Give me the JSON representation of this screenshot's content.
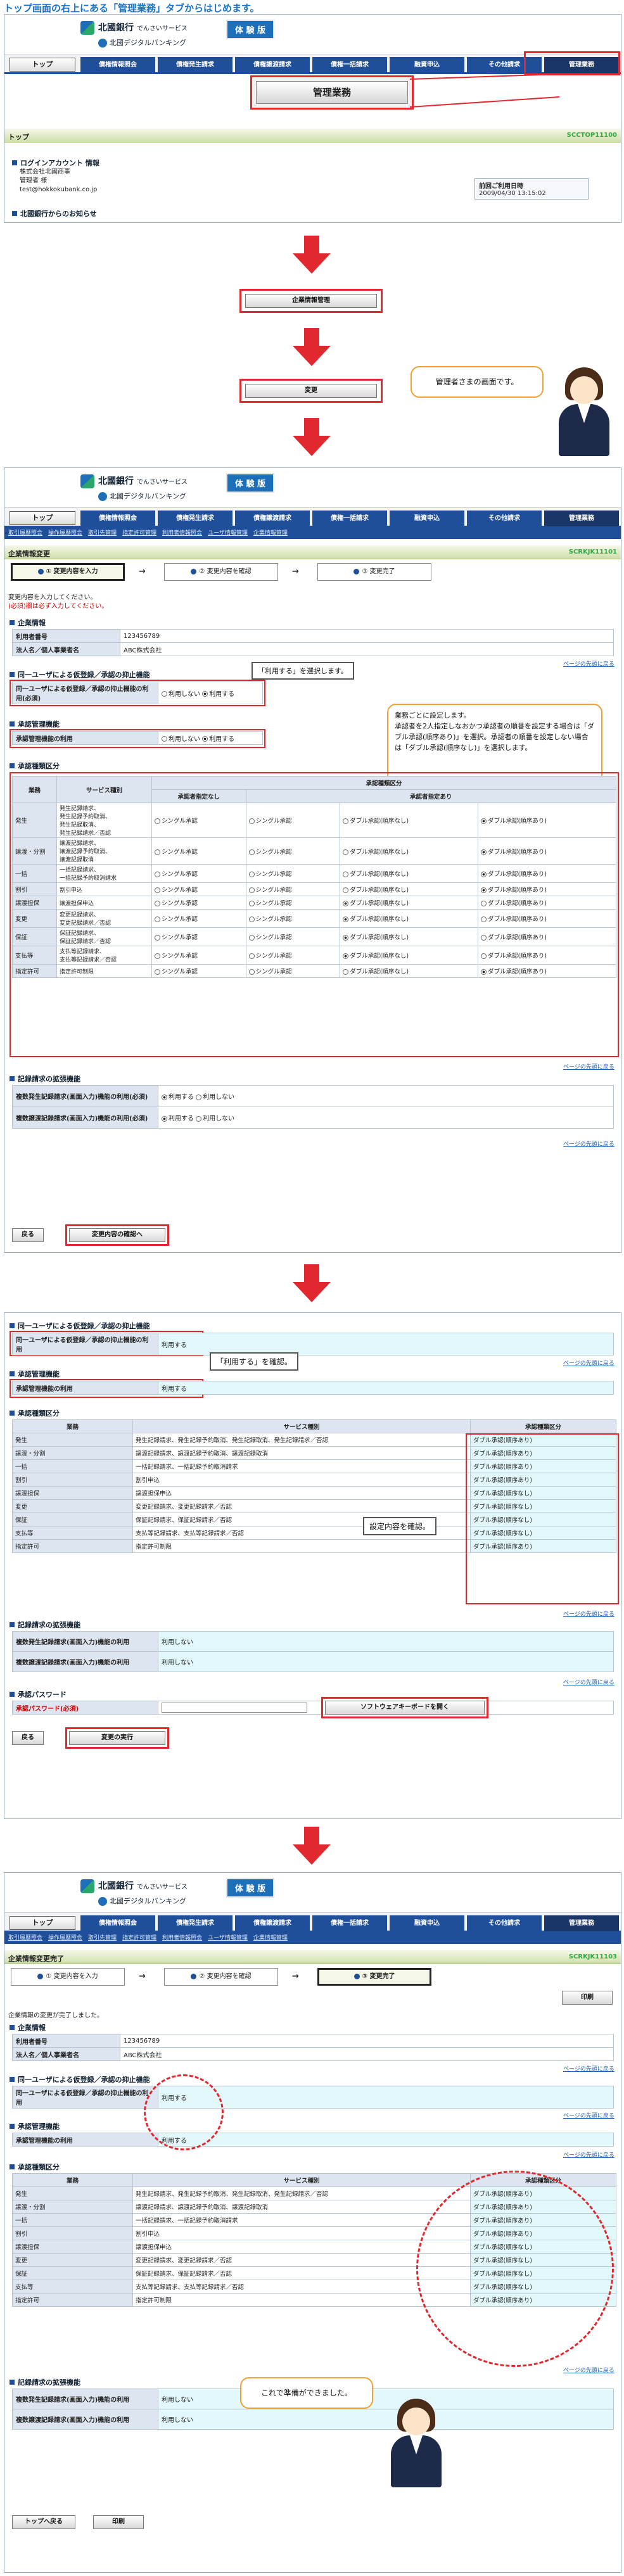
{
  "headline": "トップ画面の右上にある「管理業務」タブからはじめます。",
  "header": {
    "bank": "北國銀行",
    "bank_sub": "でんさいサービス",
    "bank_line2": "北國デジタルバンキング",
    "badge": "体 験 版"
  },
  "nav": {
    "top": "トップ",
    "tabs": [
      "債権情報照会",
      "債権発生請求",
      "債権譲渡請求",
      "債権一括請求",
      "融資申込",
      "その他請求",
      "管理業務"
    ]
  },
  "subnav": [
    "取引履歴照会",
    "操作履歴照会",
    "取引先管理",
    "指定許可管理",
    "利用者情報照会",
    "ユーザ情報管理",
    "企業情報管理"
  ],
  "s1": {
    "title": "トップ",
    "code": "SCCTOP11100",
    "big_button": "管理業務",
    "login_sec": "ログインアカウント 情報",
    "company": "株式会社北國商事",
    "user": "管理者 様",
    "email": "test@hokkokubank.co.jp",
    "prev_label": "前回ご利用日時",
    "prev_value": "2009/04/30 13:15:02",
    "notice": "北國銀行からのお知らせ"
  },
  "s2": {
    "button": "企業情報管理"
  },
  "s3": {
    "button": "変更",
    "callout": "管理者さまの画面です。"
  },
  "s4": {
    "title": "企業情報変更",
    "code": "SCRKJK11101",
    "steps": [
      "① 変更内容を入力",
      "② 変更内容を確認",
      "③ 変更完了"
    ],
    "intro1": "変更内容を入力してください。",
    "intro2": "(必須)欄は必ず入力してください。",
    "sec_company": "企業情報",
    "user_no_label": "利用者番号",
    "user_no": "123456789",
    "corp_label": "法人名／個人事業者名",
    "corp": "ABC株式会社",
    "pagetop": "ページの先頭に戻る",
    "sec_same": "同一ユーザによる仮登録／承認の抑止機能",
    "same_label": "同一ユーザによる仮登録／承認の抑止機能の利用(必須)",
    "opt_no": "利用しない",
    "opt_yes": "利用する",
    "tip_use": "「利用する」を選択します。",
    "sec_admin": "承認管理機能",
    "admin_label": "承認管理機能の利用",
    "sec_class": "承認種類区分",
    "callout": "業務ごとに設定します。\n承認者を2人指定しなおかつ承認者の順番を設定する場合は「ダブル承認(順序あり)」を選択。承認者の順番を設定しない場合は「ダブル承認(順序なし)」を選択します。",
    "col_biz": "業務",
    "col_svc": "サービス種別",
    "col_cls": "承認種類区分",
    "col_none": "承認者指定なし",
    "col_spec": "承認者指定あり",
    "opt_single": "シングル承認",
    "opt_dbl_ns": "ダブル承認(順序なし)",
    "opt_dbl_s": "ダブル承認(順序あり)",
    "rows": [
      {
        "biz": "発生",
        "svc": "発生記録請求、\n発生記録予約取消、\n発生記録取消、\n発生記録請求／否認"
      },
      {
        "biz": "譲渡・分割",
        "svc": "譲渡記録請求、\n譲渡記録予約取消、\n譲渡記録取消"
      },
      {
        "biz": "一括",
        "svc": "一括記録請求、\n一括記録予約取消請求"
      },
      {
        "biz": "割引",
        "svc": "割引申込"
      },
      {
        "biz": "譲渡担保",
        "svc": "譲渡担保申込"
      },
      {
        "biz": "変更",
        "svc": "変更記録請求、\n変更記録請求／否認"
      },
      {
        "biz": "保証",
        "svc": "保証記録請求、\n保証記録請求／否認"
      },
      {
        "biz": "支払等",
        "svc": "支払等記録請求、\n支払等記録請求／否認"
      },
      {
        "biz": "指定許可",
        "svc": "指定許可制限"
      }
    ],
    "sec_ext": "記録請求の拡張機能",
    "ext1": "複数発生記録請求(画面入力)機能の利用(必須)",
    "ext2": "複数譲渡記録請求(画面入力)機能の利用(必須)",
    "back": "戻る",
    "confirm": "変更内容の確認へ"
  },
  "s5": {
    "sec_same": "同一ユーザによる仮登録／承認の抑止機能",
    "same_label": "同一ユーザによる仮登録／承認の抑止機能の利用",
    "use": "利用する",
    "tip_use": "「利用する」を確認。",
    "sec_admin": "承認管理機能",
    "admin_label": "承認管理機能の利用",
    "sec_class": "承認種類区分",
    "col_biz": "業務",
    "col_svc": "サービス種別",
    "col_cls": "承認種類区分",
    "rows": [
      {
        "biz": "発生",
        "svc": "発生記録請求、発生記録予約取消、発生記録取消、発生記録請求／否認",
        "cls": "ダブル承認(順序あり)"
      },
      {
        "biz": "譲渡・分割",
        "svc": "譲渡記録請求、譲渡記録予約取消、譲渡記録取消",
        "cls": "ダブル承認(順序あり)"
      },
      {
        "biz": "一括",
        "svc": "一括記録請求、一括記録予約取消請求",
        "cls": "ダブル承認(順序あり)"
      },
      {
        "biz": "割引",
        "svc": "割引申込",
        "cls": "ダブル承認(順序あり)"
      },
      {
        "biz": "譲渡担保",
        "svc": "譲渡担保申込",
        "cls": "ダブル承認(順序なし)"
      },
      {
        "biz": "変更",
        "svc": "変更記録請求、変更記録請求／否認",
        "cls": "ダブル承認(順序なし)"
      },
      {
        "biz": "保証",
        "svc": "保証記録請求、保証記録請求／否認",
        "cls": "ダブル承認(順序なし)"
      },
      {
        "biz": "支払等",
        "svc": "支払等記録請求、支払等記録請求／否認",
        "cls": "ダブル承認(順序なし)"
      },
      {
        "biz": "指定許可",
        "svc": "指定許可制限",
        "cls": "ダブル承認(順序あり)"
      }
    ],
    "tip_cls": "設定内容を確認。",
    "sec_ext": "記録請求の拡張機能",
    "ext1": "複数発生記録請求(画面入力)機能の利用",
    "ext2": "複数譲渡記録請求(画面入力)機能の利用",
    "no_use": "利用しない",
    "sec_pw": "承認パスワード",
    "pw_label": "承認パスワード(必須)",
    "softkb": "ソフトウェアキーボードを開く",
    "back": "戻る",
    "exec": "変更の実行",
    "pagetop": "ページの先頭に戻る"
  },
  "s6": {
    "title": "企業情報変更完了",
    "code": "SCRKJK11103",
    "print": "印刷",
    "done_msg": "企業情報の変更が完了しました。",
    "callout": "これで準備ができました。",
    "toplink": "トップへ戻る"
  }
}
